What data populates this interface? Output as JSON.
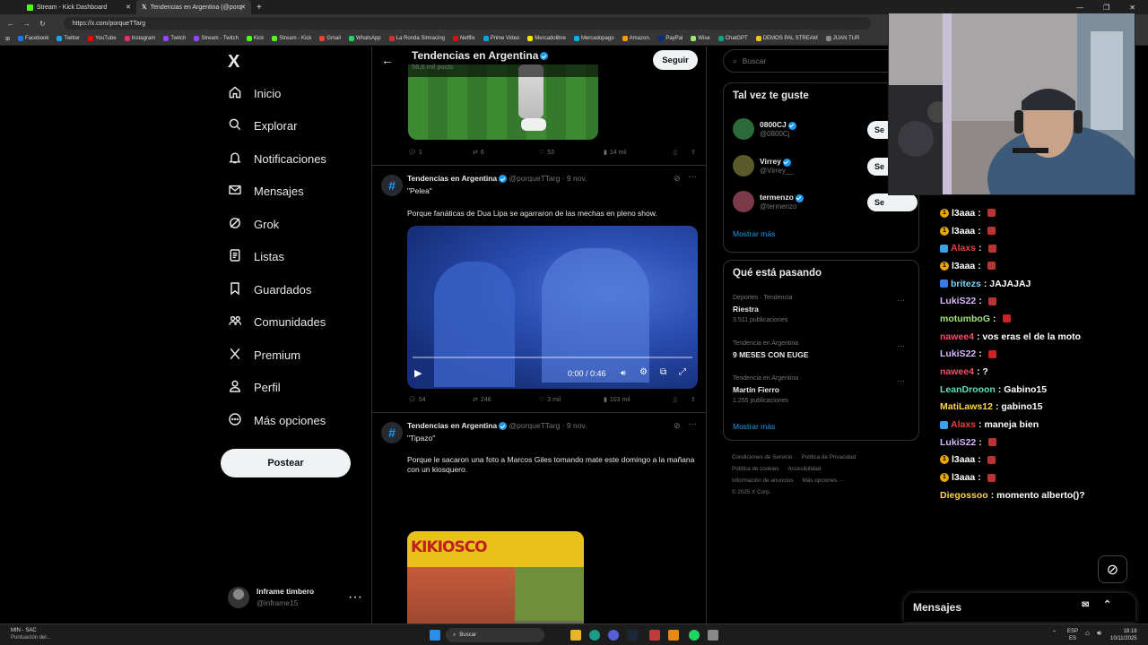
{
  "browser": {
    "tabs": [
      {
        "label": "Stream - Kick Dashboard",
        "icon": "kick-icon"
      },
      {
        "label": "Tendencias en Argentina (@porq",
        "icon": "x-icon"
      }
    ],
    "url": "https://x.com/porqueTTarg",
    "bookmarks": [
      "Facebook",
      "Twitter",
      "YouTube",
      "Instagram",
      "Twitch",
      "Stream - Twitch",
      "Kick",
      "Stream - Kick",
      "Gmail",
      "WhatsApp",
      "La Ronda Simracing",
      "Netflix",
      "Prime Video",
      "Mercadolibre",
      "Mercadopago",
      "Amazon.",
      "PayPal",
      "Wise",
      "ChatGPT",
      "DEMOS PAL STREAM",
      "JUAN TUR"
    ]
  },
  "nav": {
    "logo": "X",
    "items": [
      {
        "label": "Inicio",
        "icon": "home-icon"
      },
      {
        "label": "Explorar",
        "icon": "search-icon"
      },
      {
        "label": "Notificaciones",
        "icon": "bell-icon"
      },
      {
        "label": "Mensajes",
        "icon": "mail-icon"
      },
      {
        "label": "Grok",
        "icon": "grok-icon"
      },
      {
        "label": "Listas",
        "icon": "list-icon"
      },
      {
        "label": "Guardados",
        "icon": "bookmark-icon"
      },
      {
        "label": "Comunidades",
        "icon": "communities-icon"
      },
      {
        "label": "Premium",
        "icon": "x-premium-icon"
      },
      {
        "label": "Perfil",
        "icon": "person-icon"
      },
      {
        "label": "Más opciones",
        "icon": "more-circle-icon"
      }
    ],
    "post_label": "Postear",
    "account": {
      "name": "Inframe timbero",
      "handle": "@inframe15"
    }
  },
  "header": {
    "title": "Tendencias en Argentina",
    "subtitle": "56,6 mil posts",
    "follow_label": "Seguir"
  },
  "tweets": [
    {
      "replies": "1",
      "retweets": "6",
      "likes": "53",
      "views": "14 mil"
    },
    {
      "author": "Tendencias en Argentina",
      "handle": "@porqueTTarg",
      "date": "· 9 nov.",
      "quote": "\"Pelea\"",
      "text": "Porque fanáticas de Dua Lipa se agarraron de las mechas en pleno show.",
      "video_time": "0:00 / 0:46",
      "replies": "54",
      "retweets": "246",
      "likes": "3 mil",
      "views": "103 mil"
    },
    {
      "author": "Tendencias en Argentina",
      "handle": "@porqueTTarg",
      "date": "· 9 nov.",
      "quote": "\"Tipazo\"",
      "text": "Porque le sacaron una foto a Marcos Giles tomando mate este domingo a la mañana con un kiosquero.",
      "sign_text": "KIKIOSCO"
    }
  ],
  "right": {
    "search_placeholder": "Buscar",
    "suggest_title": "Tal vez te guste",
    "suggestions": [
      {
        "name": "0800CJ",
        "handle": "@0800Cj",
        "button": "Se"
      },
      {
        "name": "Virrey",
        "handle": "@Virrey__",
        "button": "Se"
      },
      {
        "name": "termenzo",
        "handle": "@termenzo",
        "button": "Se"
      }
    ],
    "show_more": "Mostrar más",
    "trends_title": "Qué está pasando",
    "trends": [
      {
        "context": "Deportes · Tendencia",
        "name": "Riestra",
        "count": "3.511 publicaciones"
      },
      {
        "context": "Tendencia en Argentina",
        "name": "9 MESES CON EUGE",
        "count": ""
      },
      {
        "context": "Tendencia en Argentina",
        "name": "Martín Fierro",
        "count": "1.255 publicaciones"
      }
    ],
    "footer_links": [
      "Condiciones de Servicio",
      "Política de Privacidad",
      "Política de cookies",
      "Accesibilidad",
      "Información de anuncios",
      "Más opciones ···",
      "© 2025 X Corp."
    ]
  },
  "chat": {
    "lines": [
      {
        "user": "l3aaa",
        "color": "#ffffff",
        "msg": ":",
        "emote": "#b33"
      },
      {
        "user": "l3aaa",
        "color": "#ffffff",
        "msg": ":",
        "emote": "#b33"
      },
      {
        "user": "Alaxs",
        "color": "#e34141",
        "msg": ":",
        "emote": "#b33"
      },
      {
        "user": "l3aaa",
        "color": "#ffffff",
        "msg": ":",
        "emote": "#b33"
      },
      {
        "user": "britezs",
        "color": "#7fd4f5",
        "msg": ": JAJAJAJ",
        "emote": ""
      },
      {
        "user": "LukiS22",
        "color": "#d7b8ff",
        "msg": ":",
        "emote": "#b33"
      },
      {
        "user": "motumboG",
        "color": "#a3e37a",
        "msg": ":",
        "emote": "#c22"
      },
      {
        "user": "nawee4",
        "color": "#ff4a6e",
        "msg": ": vos eras el de la moto",
        "emote": ""
      },
      {
        "user": "LukiS22",
        "color": "#d7b8ff",
        "msg": ":",
        "emote": "#c22"
      },
      {
        "user": "nawee4",
        "color": "#ff4a6e",
        "msg": ": ?",
        "emote": ""
      },
      {
        "user": "LeanDrooon",
        "color": "#5fe0b0",
        "msg": ": Gabino15",
        "emote": ""
      },
      {
        "user": "MatiLaws12",
        "color": "#ffd54a",
        "msg": ": gabino15",
        "emote": ""
      },
      {
        "user": "Alaxs",
        "color": "#e34141",
        "msg": ": maneja bien",
        "emote": ""
      },
      {
        "user": "LukiS22",
        "color": "#d7b8ff",
        "msg": ":",
        "emote": "#b33"
      },
      {
        "user": "l3aaa",
        "color": "#ffffff",
        "msg": ":",
        "emote": "#b33"
      },
      {
        "user": "l3aaa",
        "color": "#ffffff",
        "msg": ":",
        "emote": "#b33"
      },
      {
        "user": "Diegossoo",
        "color": "#ffd54a",
        "msg": ": momento alberto()?",
        "emote": ""
      }
    ]
  },
  "messages_drawer": {
    "label": "Mensajes"
  },
  "taskbar": {
    "left_title": "MIN - SAC",
    "left_subtitle": "Puntuación del...",
    "search": "Buscar",
    "lang": "ESP",
    "lang2": "ES",
    "time": "18:18",
    "date": "10/11/2025"
  }
}
